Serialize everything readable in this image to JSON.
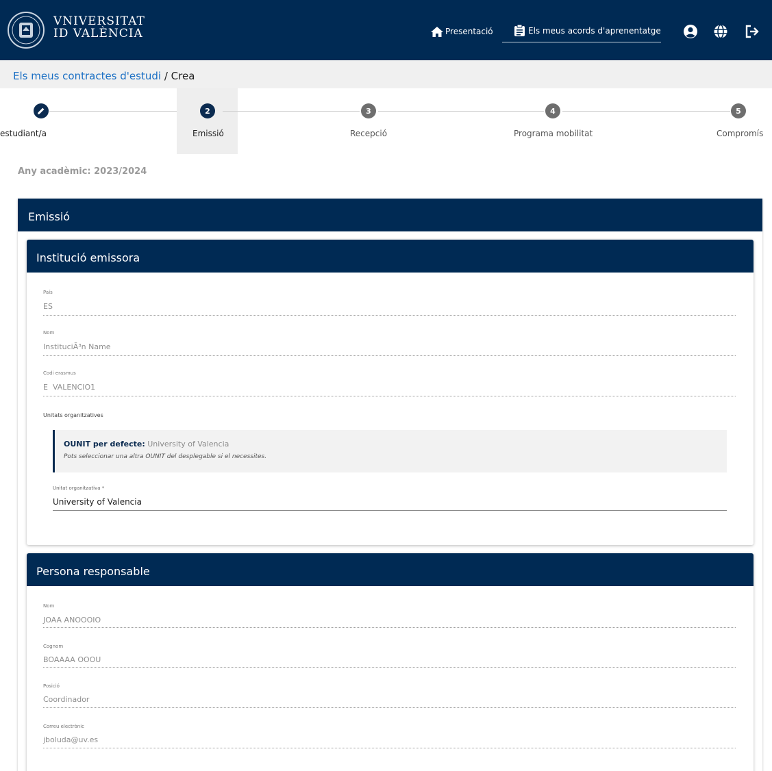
{
  "header": {
    "logo_line1": "VNIVERSITAT",
    "logo_line2": "ID VALÈNCIA",
    "nav_presentacio": "Presentació",
    "nav_acords": "Els meus acords d'aprenentatge",
    "icons": [
      "home-icon",
      "clipboard-icon",
      "user-icon",
      "globe-icon",
      "logout-icon"
    ]
  },
  "breadcrumb": {
    "link": "Els meus contractes d'estudi",
    "separator": "/",
    "current": "Crea"
  },
  "stepper": {
    "steps": [
      {
        "number": "",
        "label": "estudiant/a",
        "state": "done"
      },
      {
        "number": "2",
        "label": "Emissió",
        "state": "active"
      },
      {
        "number": "3",
        "label": "Recepció",
        "state": "todo"
      },
      {
        "number": "4",
        "label": "Programa mobilitat",
        "state": "todo"
      },
      {
        "number": "5",
        "label": "Compromís",
        "state": "todo"
      }
    ]
  },
  "academic_year": "Any acadèmic: 2023/2024",
  "section": {
    "title": "Emissió"
  },
  "institution": {
    "title": "Institució emissora",
    "fields": [
      {
        "label": "País",
        "value": "ES"
      },
      {
        "label": "Nom",
        "value": "InstituciÃ³n Name"
      },
      {
        "label": "Codi erasmus",
        "value": "E  VALENCIO1"
      }
    ],
    "ounits_label": "Unitats organitzatives",
    "ounit_default_label": "OUNIT per defecte:",
    "ounit_default_value": "University of Valencia",
    "ounit_hint": "Pots seleccionar una altra OUNIT del desplegable si el necessites.",
    "select_label": "Unitat organitzativa *",
    "select_value": "University of Valencia"
  },
  "responsible": {
    "title": "Persona responsable",
    "fields": [
      {
        "label": "Nom",
        "value": "JOAA ANOOOIO"
      },
      {
        "label": "Cognom",
        "value": "BOAAAA OOOU"
      },
      {
        "label": "Posició",
        "value": "Coordinador"
      },
      {
        "label": "Correu electrònic",
        "value": "jboluda@uv.es"
      }
    ]
  },
  "colors": {
    "navy": "#002a54",
    "link": "#1a6fc4",
    "step_todo": "#6e6e6e"
  }
}
